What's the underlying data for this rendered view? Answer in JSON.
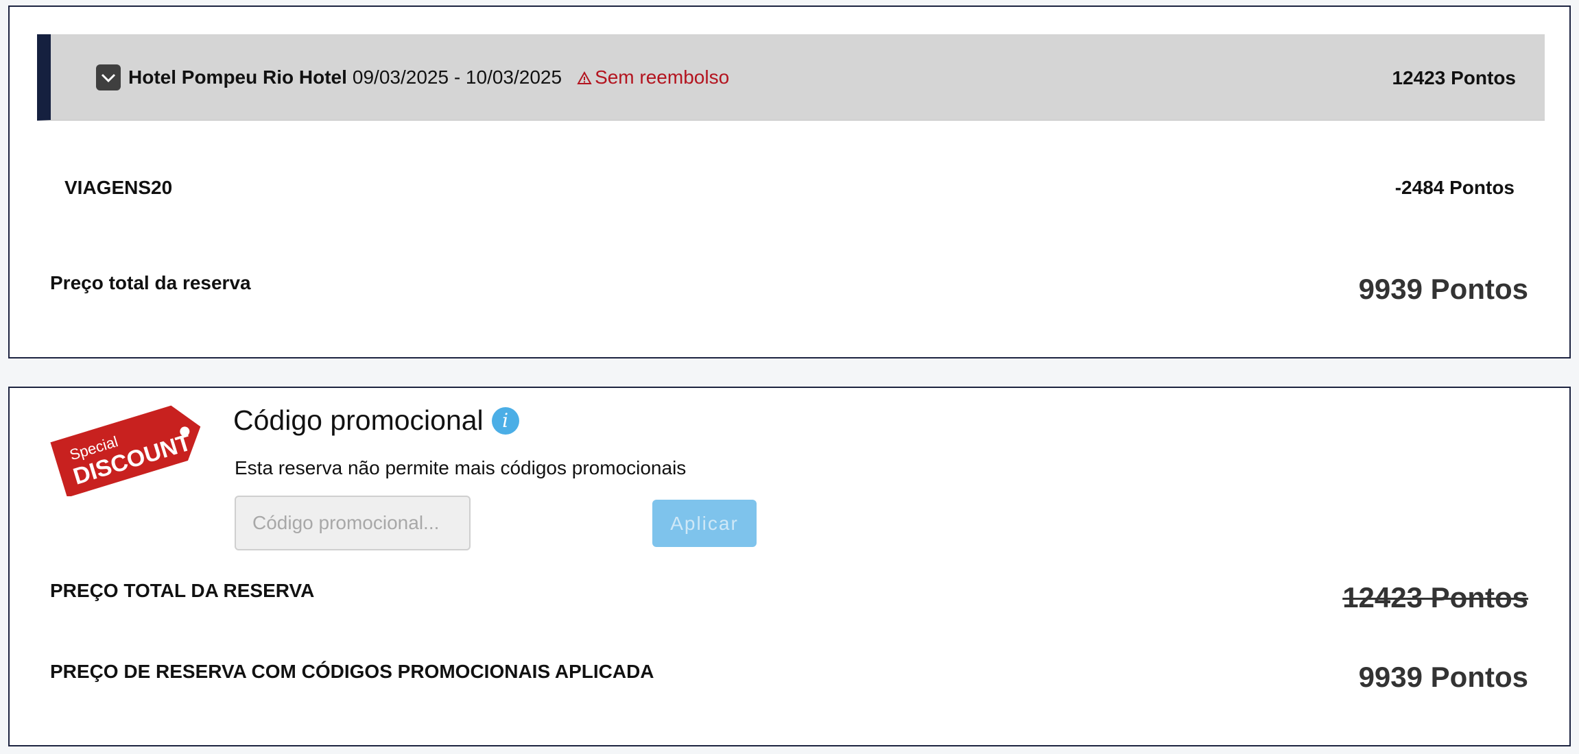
{
  "booking": {
    "hotel_name": "Hotel Pompeu Rio Hotel",
    "dates": "09/03/2025 - 10/03/2025",
    "refund_status": "Sem reembolso",
    "hotel_price": "12423 Pontos",
    "discount_code": "VIAGENS20",
    "discount_amount": "-2484 Pontos",
    "total_label": "Preço total da reserva",
    "total_value": "9939 Pontos"
  },
  "promo": {
    "tag_line1": "Special",
    "tag_line2": "DISCOUNT",
    "title": "Código promocional",
    "info_glyph": "i",
    "note": "Esta reserva não permite mais códigos promocionais",
    "input_placeholder": "Código promocional...",
    "apply_label": "Aplicar",
    "original_label": "PREÇO TOTAL DA RESERVA",
    "original_value": "12423 Pontos",
    "applied_label": "PREÇO DE RESERVA COM CÓDIGOS PROMOCIONAIS APLICADA",
    "applied_value": "9939 Pontos"
  },
  "colors": {
    "accent_bar": "#15203f",
    "warning": "#b3141f",
    "button": "#7ec3ec",
    "info": "#4baee6",
    "tag": "#c8211f"
  },
  "icons": {
    "expand": "chevron-down-icon",
    "warning": "warning-triangle-icon",
    "info": "info-icon",
    "tag": "discount-tag-icon"
  }
}
